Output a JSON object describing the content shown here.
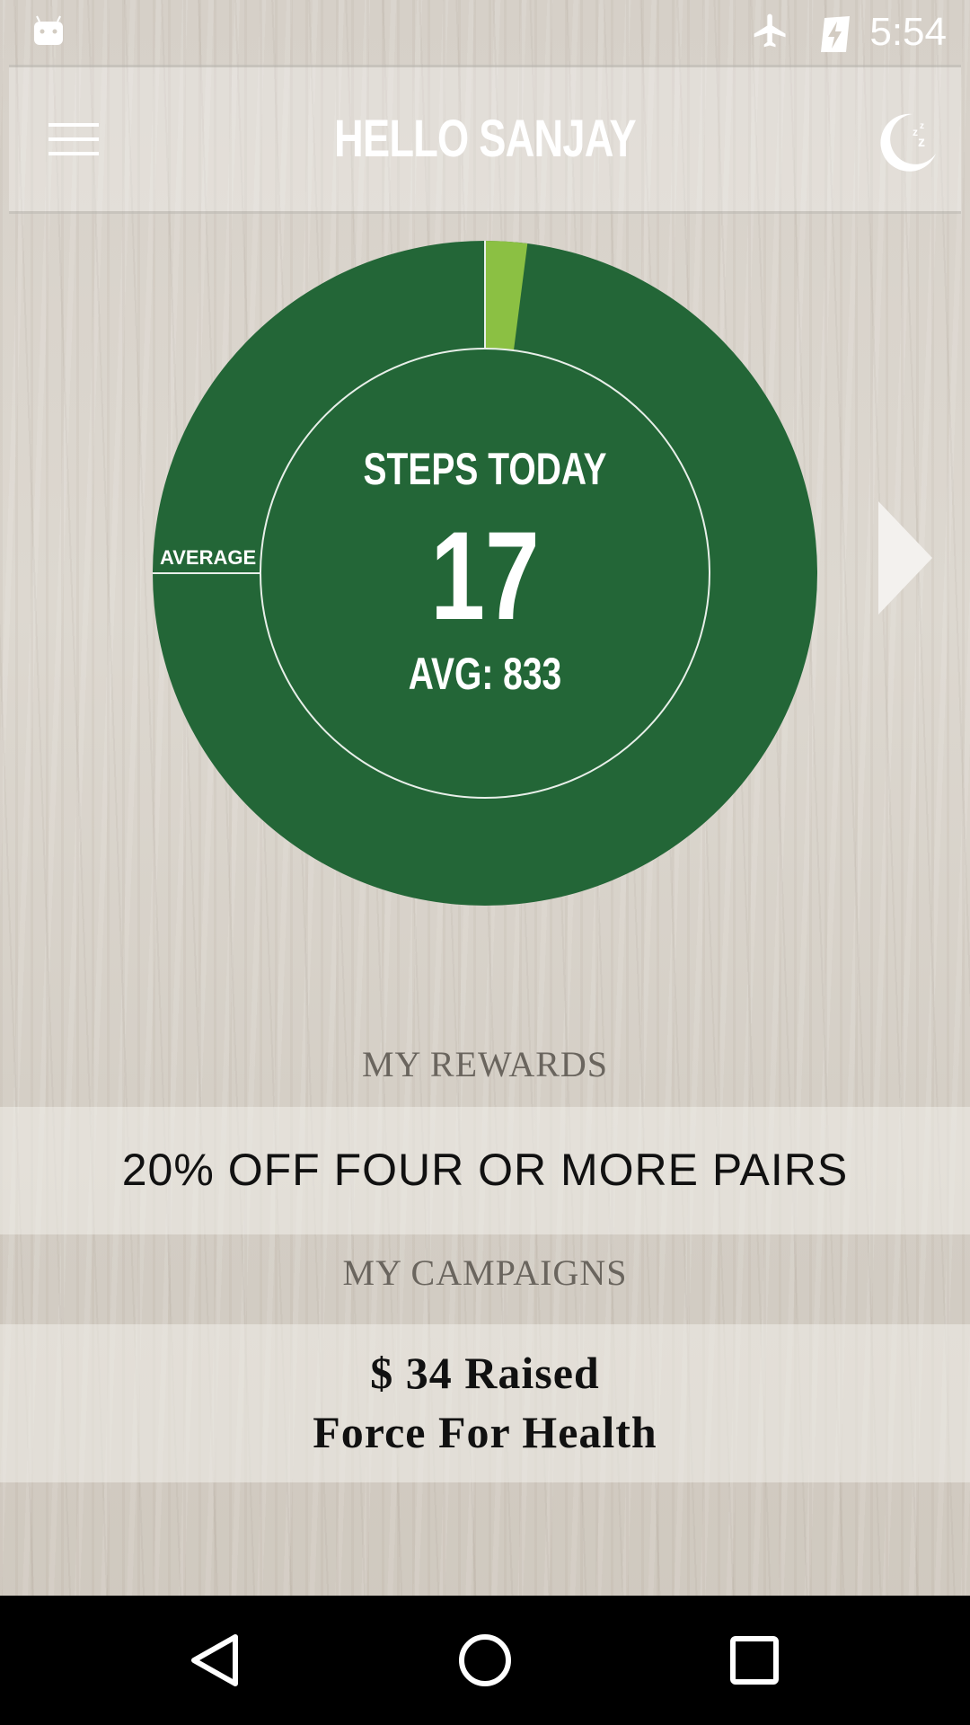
{
  "status_bar": {
    "time": "5:54",
    "icons": [
      "android-notification-icon",
      "airplane-mode-icon",
      "battery-charging-icon"
    ]
  },
  "header": {
    "title": "HELLO SANJAY",
    "menu_icon": "hamburger-menu-icon",
    "sleep_icon": "moon-sleep-icon"
  },
  "chart_data": {
    "type": "pie",
    "title": "STEPS TODAY",
    "value": 17,
    "value_label": "17",
    "average": 833,
    "average_label": "AVG: 833",
    "marker_label": "AVERAGE",
    "progress_fraction_of_average": 0.0204,
    "colors": {
      "ring": "#236637",
      "progress": "#8bc043",
      "marker": "#e8efe9"
    }
  },
  "rewards": {
    "title": "MY REWARDS",
    "item": "20% OFF FOUR OR MORE PAIRS"
  },
  "campaigns": {
    "title": "MY CAMPAIGNS",
    "raised": "$ 34 Raised",
    "name": "Force For Health"
  },
  "nav_bar": {
    "back_icon": "back-triangle-icon",
    "home_icon": "home-circle-icon",
    "recents_icon": "recents-square-icon"
  }
}
